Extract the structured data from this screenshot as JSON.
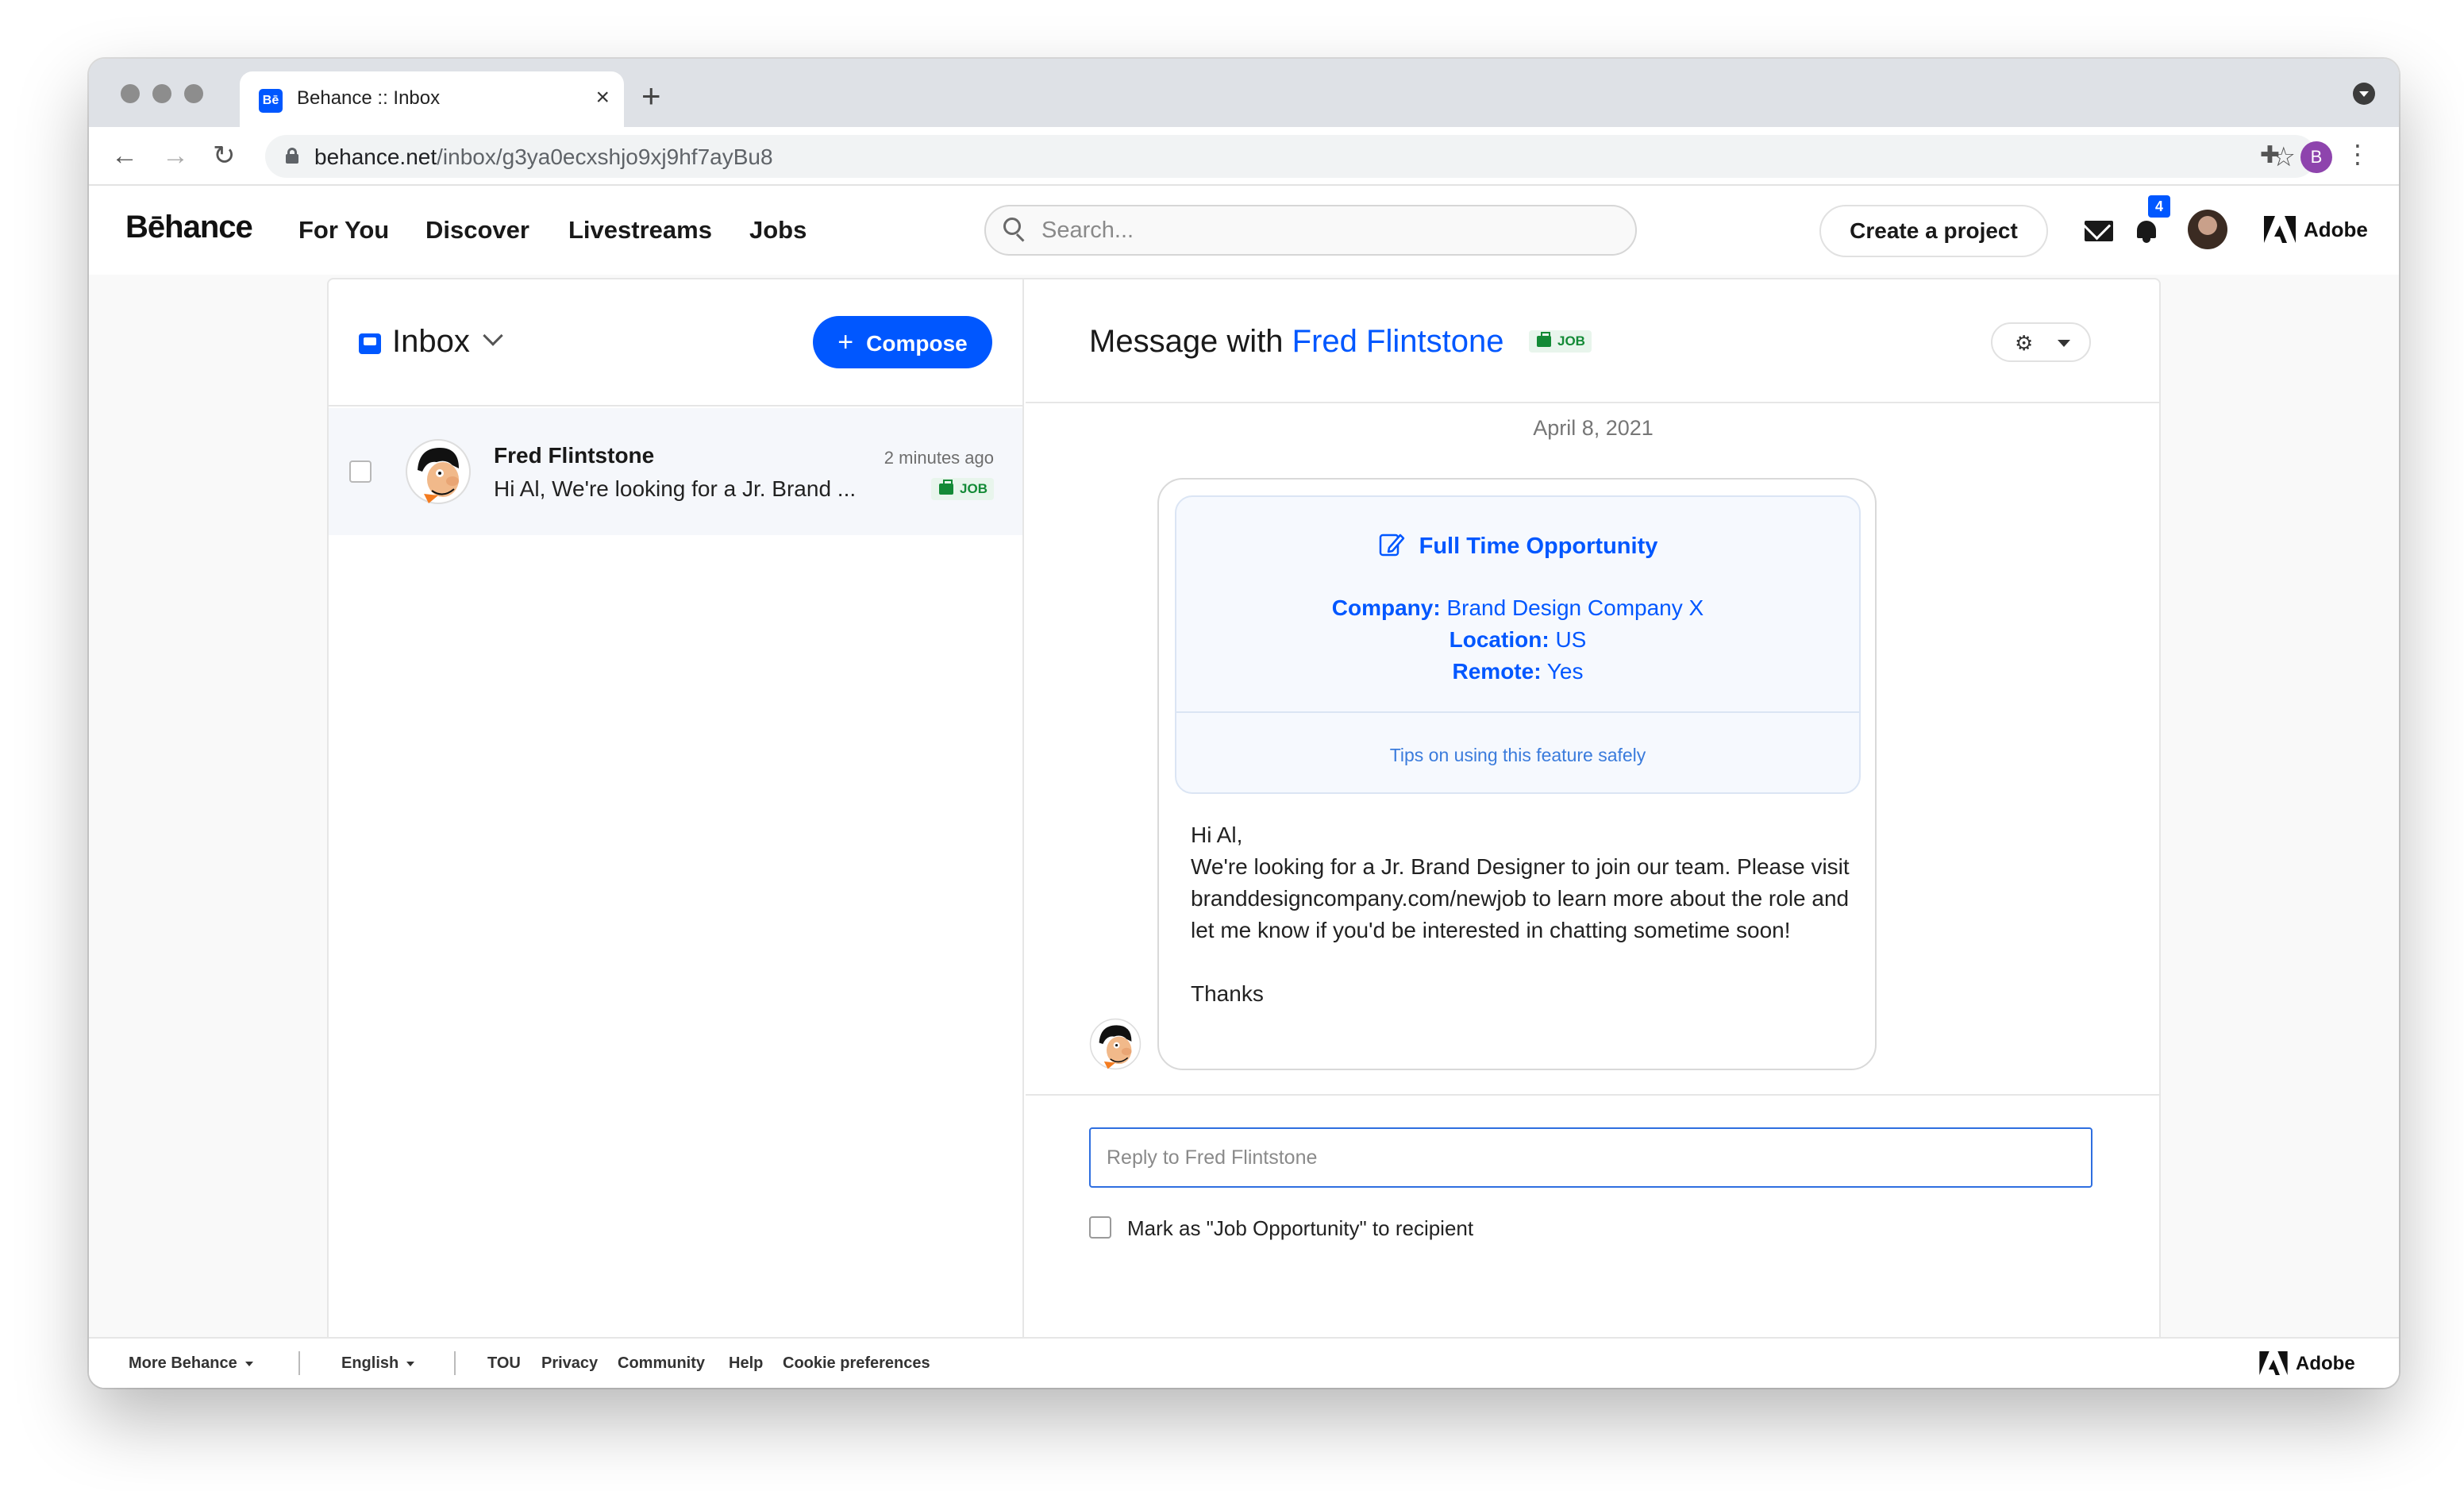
{
  "browser": {
    "tab_title": "Behance :: Inbox",
    "tab_favicon": "Bē",
    "url_host": "behance.net",
    "url_path": "/inbox/g3ya0ecxshjo9xj9hf7ayBu8",
    "profile_initial": "B"
  },
  "header": {
    "logo": "Bēhance",
    "nav": [
      "For You",
      "Discover",
      "Livestreams",
      "Jobs"
    ],
    "search_placeholder": "Search...",
    "create_label": "Create a project",
    "notification_count": "4",
    "adobe_label": "Adobe"
  },
  "inbox": {
    "title": "Inbox",
    "compose_label": "Compose",
    "threads": [
      {
        "name": "Fred Flintstone",
        "time": "2 minutes ago",
        "preview": "Hi Al, We're looking for a Jr. Brand ...",
        "tag": "JOB"
      }
    ]
  },
  "conversation": {
    "title_prefix": "Message with ",
    "contact": "Fred Flintstone",
    "tag": "JOB",
    "date": "April 8, 2021",
    "opportunity": {
      "title": "Full Time Opportunity",
      "company_label": "Company:",
      "company": "Brand Design Company X",
      "location_label": "Location:",
      "location": "US",
      "remote_label": "Remote:",
      "remote": "Yes",
      "tips": "Tips on using this feature safely"
    },
    "message": {
      "greeting": "Hi Al,",
      "body": "We're looking for a Jr. Brand Designer to join our team. Please visit branddesigncompany.com/newjob to learn more about the role and let me know if you'd be interested in chatting sometime soon!",
      "signoff": "Thanks"
    },
    "reply_placeholder": "Reply to Fred Flintstone",
    "mark_label": "Mark as \"Job Opportunity\" to recipient"
  },
  "footer": {
    "more": "More Behance",
    "language": "English",
    "links": [
      "TOU",
      "Privacy",
      "Community",
      "Help",
      "Cookie preferences"
    ],
    "adobe_label": "Adobe"
  },
  "colors": {
    "brand_blue": "#0057ff",
    "job_green": "#138a36"
  }
}
